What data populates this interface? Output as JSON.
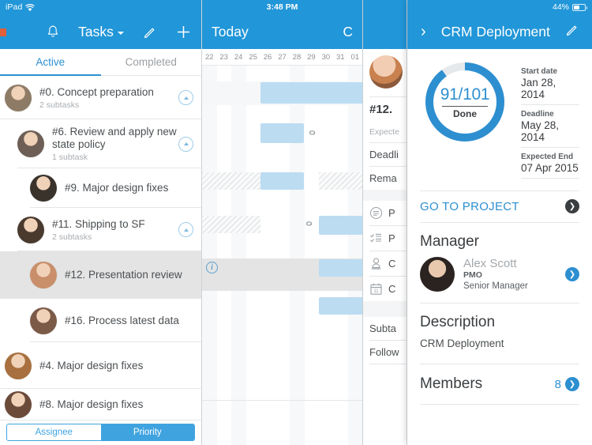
{
  "status_bar": {
    "device": "iPad",
    "time": "3:48 PM",
    "battery": "44%",
    "wifi_icon": "wifi-icon",
    "battery_icon": "battery-icon"
  },
  "task_list": {
    "menu_icon": "hamburger-menu-icon",
    "bell_icon": "notification-bell-icon",
    "title": "Tasks",
    "dropdown_icon": "chevron-down-icon",
    "edit_icon": "pencil-edit-icon",
    "add_icon": "plus-add-icon",
    "tabs": [
      {
        "label": "Active",
        "active": true
      },
      {
        "label": "Completed",
        "active": false
      }
    ],
    "rows": [
      {
        "title": "#0. Concept preparation",
        "sub": "2 subtasks",
        "expand": true,
        "indent": 0,
        "selected": false,
        "avatar": "#8e7b66"
      },
      {
        "title": "#6. Review and apply new state policy",
        "sub": "1 subtask",
        "expand": true,
        "indent": 1,
        "selected": false,
        "avatar": "#6d5f55"
      },
      {
        "title": "#9. Major design fixes",
        "sub": "",
        "expand": false,
        "indent": 2,
        "selected": false,
        "avatar": "#3a332c"
      },
      {
        "title": "#11. Shipping to SF",
        "sub": "2 subtasks",
        "expand": true,
        "indent": 1,
        "selected": false,
        "avatar": "#4a3a2e"
      },
      {
        "title": "#12. Presentation review",
        "sub": "",
        "expand": false,
        "indent": 2,
        "selected": true,
        "avatar": "#c98f6a"
      },
      {
        "title": "#16. Process latest data",
        "sub": "",
        "expand": false,
        "indent": 2,
        "selected": false,
        "avatar": "#7b5a48"
      },
      {
        "title": "#4. Major design fixes",
        "sub": "",
        "expand": false,
        "indent": 0,
        "selected": false,
        "avatar": "#a8703f"
      },
      {
        "title": "#8. Major design fixes",
        "sub": "",
        "expand": false,
        "indent": 0,
        "selected": false,
        "avatar": "#6b4a3a"
      }
    ],
    "segmented": [
      {
        "label": "Assignee",
        "selected": false
      },
      {
        "label": "Priority",
        "selected": true
      }
    ]
  },
  "gantt": {
    "title": "Today",
    "right_label": "C",
    "dates": [
      "22",
      "23",
      "24",
      "25",
      "26",
      "27",
      "28",
      "29",
      "30",
      "31",
      "01"
    ],
    "info_icon": "info-circle-icon",
    "link_icon": "link-chain-icon"
  },
  "task_detail": {
    "title": "#12.",
    "expected_label": "Expecte",
    "deadline_label": "Deadli",
    "remaining_label": "Rema",
    "rows": [
      {
        "icon": "description-icon",
        "text": "P"
      },
      {
        "icon": "checklist-icon",
        "text": "P"
      },
      {
        "icon": "assignee-stamp-icon",
        "text": "C"
      },
      {
        "icon": "calendar-icon",
        "text": "C"
      }
    ],
    "subtasks_label": "Subta",
    "followers_label": "Follow"
  },
  "project": {
    "back_icon": "chevron-right-icon",
    "title": "CRM Deployment",
    "edit_icon": "pencil-edit-icon",
    "progress": {
      "value": "91/101",
      "caption": "Done",
      "percent": 90,
      "ring_color": "#2d8fd0",
      "track_color": "#e6e9eb"
    },
    "dates": [
      {
        "label": "Start date",
        "value": "Jan 28, 2014"
      },
      {
        "label": "Deadline",
        "value": "May 28, 2014"
      },
      {
        "label": "Expected End",
        "value": "07 Apr 2015"
      }
    ],
    "goto_project": {
      "label": "GO TO PROJECT",
      "arrow_icon": "arrow-right-icon"
    },
    "manager": {
      "heading": "Manager",
      "name": "Alex Scott",
      "role": "PMO",
      "role2": "Senior Manager",
      "arrow_icon": "arrow-right-icon",
      "avatar": "#2e2a28"
    },
    "description": {
      "heading": "Description",
      "text": "CRM Deployment"
    },
    "members": {
      "heading": "Members",
      "count": "8",
      "arrow_icon": "arrow-right-icon"
    }
  }
}
